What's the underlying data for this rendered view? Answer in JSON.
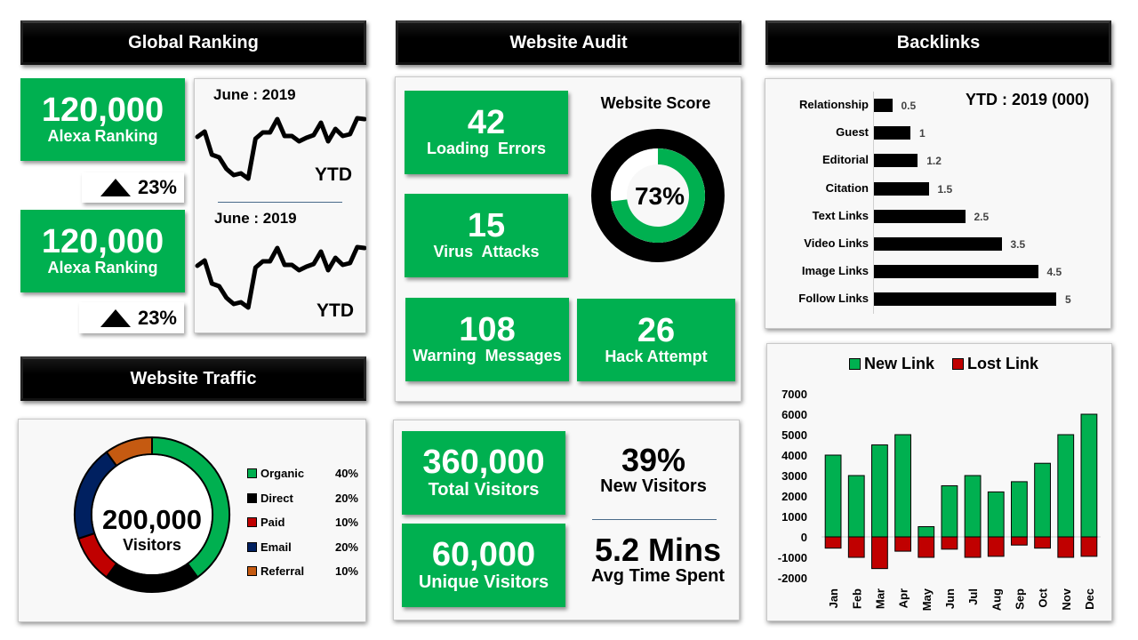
{
  "colors": {
    "green": "#00b050",
    "black": "#000000",
    "red": "#c00000",
    "navy": "#002060",
    "orange": "#c55a11"
  },
  "global_ranking": {
    "header": "Global Ranking",
    "cards": [
      {
        "value": "120,000",
        "label": "Alexa Ranking",
        "change": "23%",
        "change_icon": "triangle-up-icon",
        "spark_title": "June : 2019",
        "spark_label": "YTD"
      },
      {
        "value": "120,000",
        "label": "Alexa Ranking",
        "change": "23%",
        "change_icon": "triangle-up-icon",
        "spark_title": "June : 2019",
        "spark_label": "YTD"
      }
    ],
    "sparkline": [
      47,
      53,
      27,
      24,
      11,
      4,
      6,
      0,
      45,
      52,
      52,
      67,
      48,
      48,
      42,
      46,
      49,
      63,
      42,
      56,
      48,
      50,
      68,
      67
    ]
  },
  "website_audit": {
    "header": "Website Audit",
    "metrics": [
      {
        "value": "42",
        "label": "Loading  Errors"
      },
      {
        "value": "15",
        "label": "Virus  Attacks"
      },
      {
        "value": "108",
        "label": "Warning  Messages"
      },
      {
        "value": "26",
        "label": "Hack Attempt"
      }
    ],
    "score": {
      "title": "Website Score",
      "value": 73,
      "label": "73%"
    }
  },
  "backlinks": {
    "header": "Backlinks",
    "subtitle": "YTD : 2019 (000)"
  },
  "website_traffic": {
    "header": "Website Traffic",
    "total": "200,000",
    "total_label": "Visitors",
    "segments": [
      {
        "name": "Organic",
        "pct": 40,
        "label": "40%",
        "color": "#00b050"
      },
      {
        "name": "Direct",
        "pct": 20,
        "label": "20%",
        "color": "#000000"
      },
      {
        "name": "Paid",
        "pct": 10,
        "label": "10%",
        "color": "#c00000"
      },
      {
        "name": "Email",
        "pct": 20,
        "label": "20%",
        "color": "#002060"
      },
      {
        "name": "Referral",
        "pct": 10,
        "label": "10%",
        "color": "#c55a11"
      }
    ]
  },
  "visitors": {
    "total": {
      "value": "360,000",
      "label": "Total Visitors"
    },
    "unique": {
      "value": "60,000",
      "label": "Unique Visitors"
    },
    "new": {
      "value": "39%",
      "label": "New Visitors"
    },
    "time": {
      "value": "5.2 Mins",
      "label": "Avg Time Spent"
    }
  },
  "chart_data": [
    {
      "type": "bar",
      "orientation": "horizontal",
      "title": "YTD : 2019 (000)",
      "categories": [
        "Relationship",
        "Guest",
        "Editorial",
        "Citation",
        "Text Links",
        "Video Links",
        "Image Links",
        "Follow Links"
      ],
      "values": [
        0.5,
        1,
        1.2,
        1.5,
        2.5,
        3.5,
        4.5,
        5
      ],
      "data_labels": [
        "0.5",
        "1",
        "1.2",
        "1.5",
        "2.5",
        "3.5",
        "4.5",
        "5"
      ],
      "xlim": [
        0,
        5.5
      ],
      "grid": false
    },
    {
      "type": "bar",
      "stacked": true,
      "categories": [
        "Jan",
        "Feb",
        "Mar",
        "Apr",
        "May",
        "Jun",
        "Jul",
        "Aug",
        "Sep",
        "Oct",
        "Nov",
        "Dec"
      ],
      "series": [
        {
          "name": "New Link",
          "color": "#00b050",
          "values": [
            4000,
            3000,
            4500,
            5000,
            500,
            2500,
            3000,
            2200,
            2700,
            3600,
            5000,
            6000
          ]
        },
        {
          "name": "Lost Link",
          "color": "#c00000",
          "values": [
            -550,
            -1000,
            -1550,
            -700,
            -1000,
            -600,
            -1000,
            -950,
            -400,
            -550,
            -1000,
            -950
          ]
        }
      ],
      "ylim": [
        -2000,
        7000
      ],
      "yticks": [
        "7000",
        "6000",
        "5000",
        "4000",
        "3000",
        "2000",
        "1000",
        "0",
        "-1000",
        "-2000"
      ],
      "legend": "top",
      "grid": false
    }
  ]
}
